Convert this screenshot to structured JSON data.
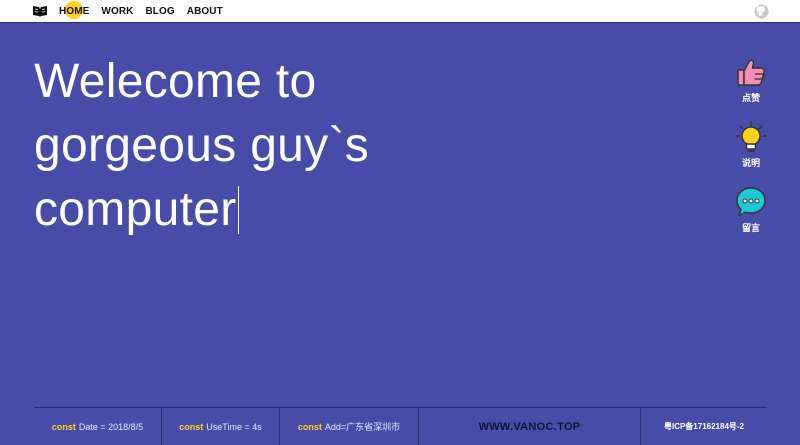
{
  "nav": {
    "items": [
      {
        "label": "HOME",
        "active": true
      },
      {
        "label": "WORK"
      },
      {
        "label": "BLOG"
      },
      {
        "label": "ABOUT"
      }
    ]
  },
  "hero": {
    "lines": [
      "Welecome to",
      "gorgeous guy`s",
      "computer"
    ]
  },
  "side": {
    "like_label": "点赞",
    "info_label": "说明",
    "message_label": "留言"
  },
  "footer": {
    "keyword": "const",
    "date_text": "Date = 2018/8/5",
    "usetime_text": "UseTime = 4s",
    "add_text": "Add=广东省深圳市",
    "site": "WWW.VANOC.TOP",
    "icp": "粤ICP备17162184号-2"
  },
  "colors": {
    "background": "#474ca9",
    "accent": "#ffd21f",
    "like_icon": "#f48fb1",
    "message_icon": "#1ec9d6"
  },
  "icons": {
    "logo": "book-logo-icon",
    "github": "github-icon",
    "like": "thumbs-up-icon",
    "info": "lightbulb-icon",
    "message": "chat-bubble-icon"
  }
}
